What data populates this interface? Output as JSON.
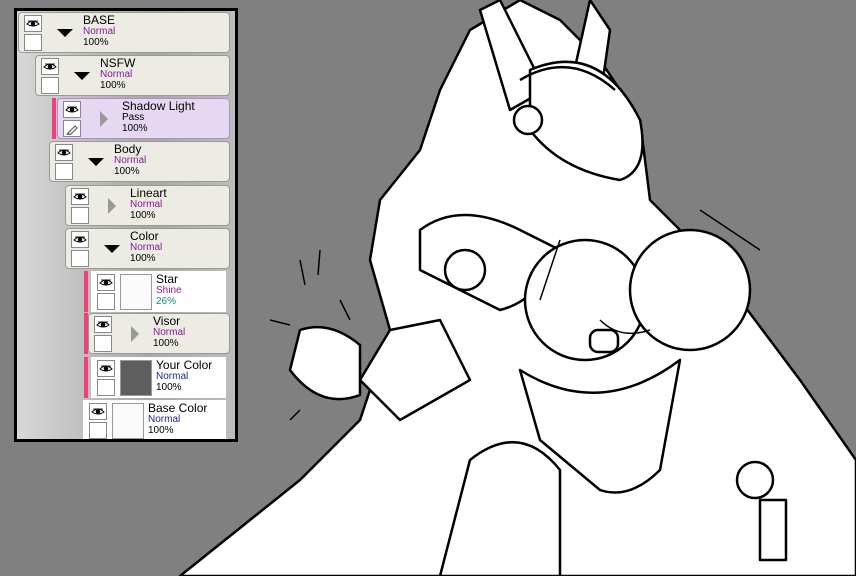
{
  "layers": [
    {
      "name": "BASE",
      "mode": "Normal",
      "opacity": "100%",
      "type": "folder",
      "expanded": true
    },
    {
      "name": "NSFW",
      "mode": "Normal",
      "opacity": "100%",
      "type": "folder",
      "expanded": true
    },
    {
      "name": "Shadow Light",
      "mode": "Pass",
      "opacity": "100%",
      "type": "folder",
      "expanded": false,
      "selected": true
    },
    {
      "name": "Body",
      "mode": "Normal",
      "opacity": "100%",
      "type": "folder",
      "expanded": true
    },
    {
      "name": "Lineart",
      "mode": "Normal",
      "opacity": "100%",
      "type": "folder",
      "expanded": false
    },
    {
      "name": "Color",
      "mode": "Normal",
      "opacity": "100%",
      "type": "folder",
      "expanded": true
    },
    {
      "name": "Star",
      "mode": "Shine",
      "opacity": "26%",
      "type": "layer"
    },
    {
      "name": "Visor",
      "mode": "Normal",
      "opacity": "100%",
      "type": "folder",
      "expanded": false
    },
    {
      "name": "Your Color",
      "mode": "Normal",
      "opacity": "100%",
      "type": "layer"
    },
    {
      "name": "Base Color",
      "mode": "Normal",
      "opacity": "100%",
      "type": "layer"
    }
  ],
  "colors": {
    "clip_bar": "#f0407a",
    "canvas": "#808080",
    "your_color_thumb": "#5e5e5e"
  }
}
